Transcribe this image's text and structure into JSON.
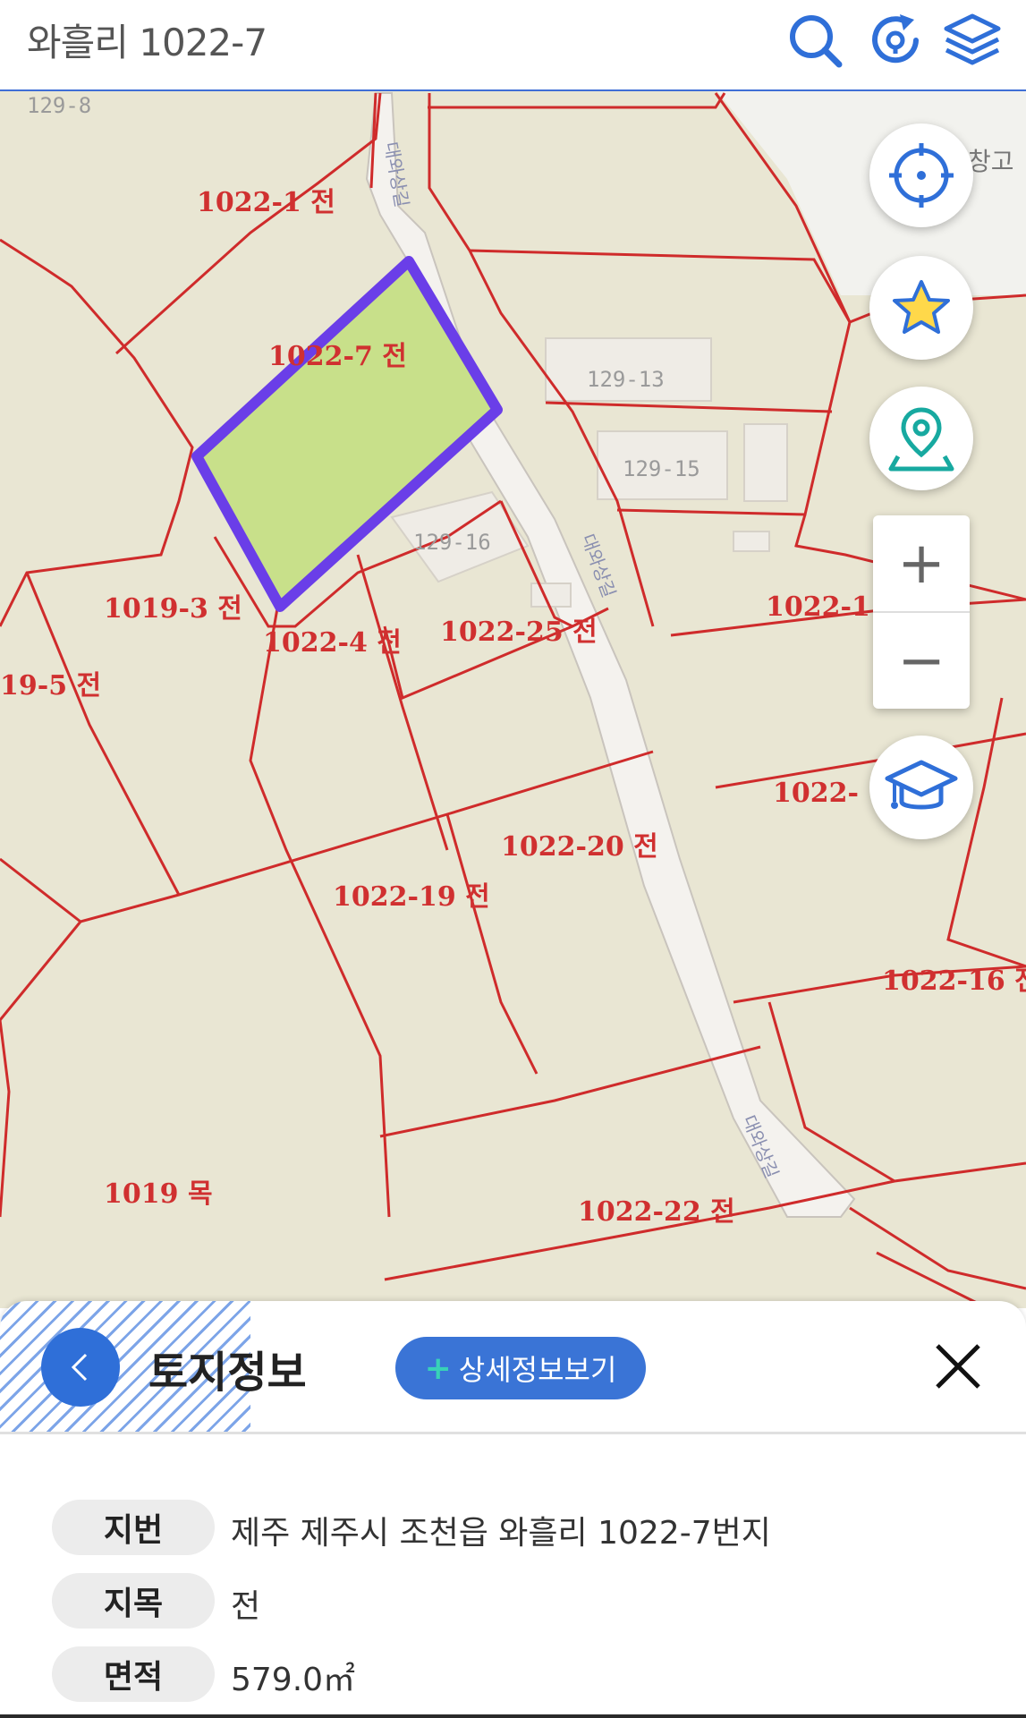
{
  "header": {
    "title": "와흘리 1022-7"
  },
  "map": {
    "parcels": [
      {
        "label": "1022-1 전"
      },
      {
        "label": "1022-7 전"
      },
      {
        "label": "1019-3 전"
      },
      {
        "label": "1022-4 전"
      },
      {
        "label": "1022-25 전"
      },
      {
        "label": "19-5 전"
      },
      {
        "label": "1022-20 전"
      },
      {
        "label": "1022-19 전"
      },
      {
        "label": "1019 목"
      },
      {
        "label": "1022-22 전"
      },
      {
        "label": "1022-16 전"
      },
      {
        "label": "1022-1"
      },
      {
        "label": "1022-"
      }
    ],
    "buildings": [
      {
        "label": "129-13"
      },
      {
        "label": "129-15"
      },
      {
        "label": "129-16"
      },
      {
        "label": "129-8"
      },
      {
        "label": "창고"
      }
    ],
    "roads": [
      {
        "label": "대와상길"
      },
      {
        "label": "대와상길"
      },
      {
        "label": "대와상길"
      }
    ],
    "selected_fill": "#c8e08a",
    "selected_border": "#6a3ee8",
    "parcel_line_color": "#cf2b2b"
  },
  "controls": {
    "locate_icon": "crosshair-icon",
    "favorite_icon": "star-icon",
    "map_pin_icon": "map-pin-icon",
    "zoom_in": "+",
    "zoom_out": "−",
    "education_icon": "graduation-cap-icon"
  },
  "panel": {
    "title": "토지정보",
    "detail_button": "상세정보보기",
    "detail_plus": "+",
    "rows": [
      {
        "label": "지번",
        "value": "제주 제주시 조천읍 와흘리 1022-7번지"
      },
      {
        "label": "지목",
        "value": "전"
      },
      {
        "label": "면적",
        "value": "579.0㎡"
      }
    ]
  }
}
